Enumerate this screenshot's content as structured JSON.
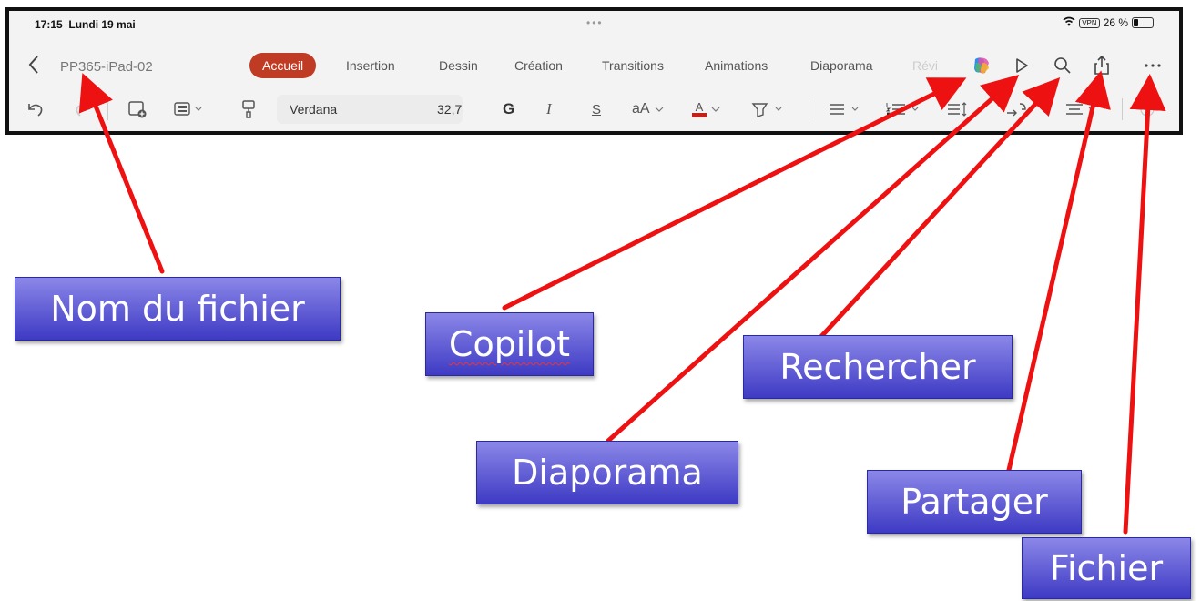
{
  "status": {
    "time": "17:15",
    "date": "Lundi 19 mai",
    "dots": "•••",
    "vpn": "VPN",
    "battery": "26 %",
    "battery_level": 0.26
  },
  "file": {
    "name": "PP365-iPad-02"
  },
  "tabs": [
    {
      "label": "Accueil",
      "active": true
    },
    {
      "label": "Insertion"
    },
    {
      "label": "Dessin"
    },
    {
      "label": "Création"
    },
    {
      "label": "Transitions"
    },
    {
      "label": "Animations"
    },
    {
      "label": "Diaporama"
    },
    {
      "label": "Révi"
    }
  ],
  "format": {
    "font": "Verdana",
    "size": "32,7",
    "bold": "G",
    "italic": "I",
    "strike": "S",
    "case": "aA",
    "font_color": "A"
  },
  "accent": "#c03b24",
  "callouts": {
    "file_name": "Nom du fichier",
    "copilot": "Copilot",
    "diaporama": "Diaporama",
    "rechercher": "Rechercher",
    "partager": "Partager",
    "fichier": "Fichier"
  },
  "icons": [
    "back-icon",
    "copilot-icon",
    "play-icon",
    "search-icon",
    "share-icon",
    "more-icon",
    "undo-icon",
    "redo-icon",
    "new-slide-icon",
    "layout-icon",
    "format-painter-icon",
    "bullets-icon",
    "numbering-icon",
    "line-spacing-icon",
    "align-icon"
  ]
}
